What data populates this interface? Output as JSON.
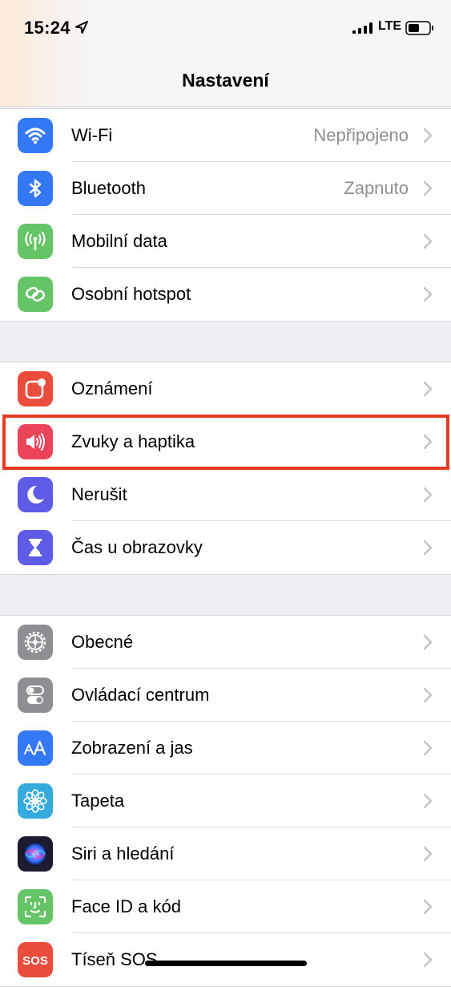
{
  "status_bar": {
    "time": "15:24",
    "network": "LTE"
  },
  "nav": {
    "title": "Nastavení"
  },
  "groups": [
    {
      "rows": [
        {
          "label": "Wi-Fi",
          "value": "Nepřipojeno",
          "icon": "wifi-icon",
          "color": "#3478f6"
        },
        {
          "label": "Bluetooth",
          "value": "Zapnuto",
          "icon": "bluetooth-icon",
          "color": "#3478f6"
        },
        {
          "label": "Mobilní data",
          "value": "",
          "icon": "antenna-icon",
          "color": "#65c466"
        },
        {
          "label": "Osobní hotspot",
          "value": "",
          "icon": "hotspot-icon",
          "color": "#65c466"
        }
      ]
    },
    {
      "rows": [
        {
          "label": "Oznámení",
          "value": "",
          "icon": "notifications-icon",
          "color": "#eb4d3d"
        },
        {
          "label": "Zvuky a haptika",
          "value": "",
          "icon": "speaker-icon",
          "color": "#eb445a"
        },
        {
          "label": "Nerušit",
          "value": "",
          "icon": "moon-icon",
          "color": "#5e5ce6"
        },
        {
          "label": "Čas u obrazovky",
          "value": "",
          "icon": "hourglass-icon",
          "color": "#5e5ce6"
        }
      ]
    },
    {
      "rows": [
        {
          "label": "Obecné",
          "value": "",
          "icon": "gear-icon",
          "color": "#8e8e93"
        },
        {
          "label": "Ovládací centrum",
          "value": "",
          "icon": "toggles-icon",
          "color": "#8e8e93"
        },
        {
          "label": "Zobrazení a jas",
          "value": "",
          "icon": "text-size-icon",
          "color": "#3478f6"
        },
        {
          "label": "Tapeta",
          "value": "",
          "icon": "flower-icon",
          "color": "#35aadc"
        },
        {
          "label": "Siri a hledání",
          "value": "",
          "icon": "siri-icon",
          "color": "#1c1c2e"
        },
        {
          "label": "Face ID a kód",
          "value": "",
          "icon": "face-id-icon",
          "color": "#65c466"
        },
        {
          "label": "Tíseň SOS",
          "value": "",
          "icon": "sos-icon",
          "color": "#eb4d3d",
          "icon_text": "SOS"
        }
      ]
    }
  ],
  "highlighted_row": "Zvuky a haptika",
  "highlight_color": "#e63a24"
}
